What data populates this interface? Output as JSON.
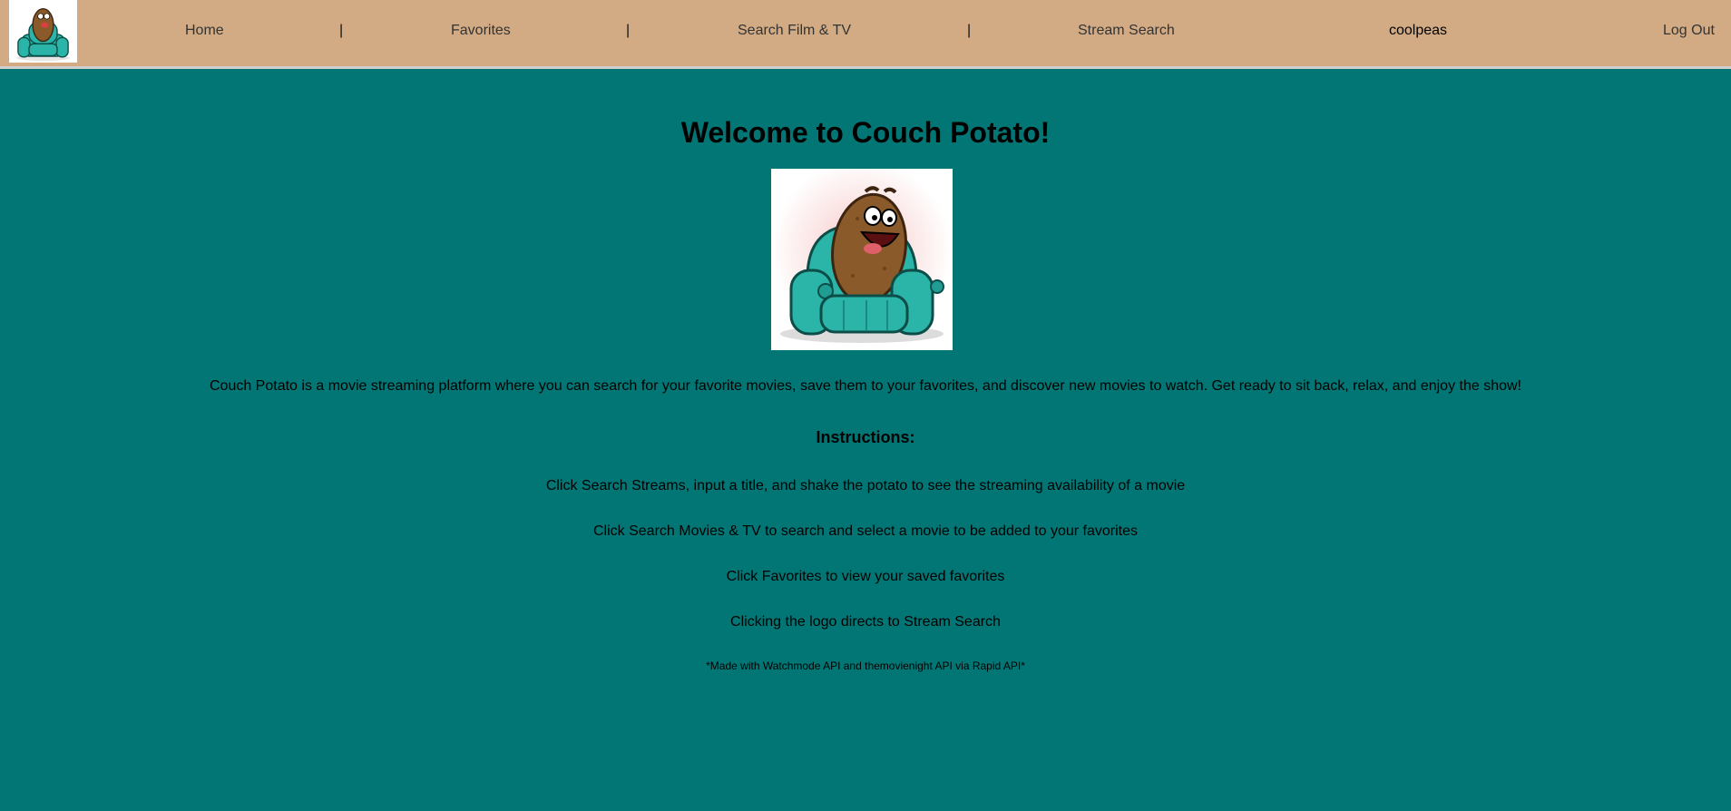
{
  "nav": {
    "logo_alt": "Couch Potato logo",
    "home": "Home",
    "favorites": "Favorites",
    "search_film_tv": "Search Film & TV",
    "stream_search": "Stream Search",
    "separator": "|",
    "username": "coolpeas",
    "logout": "Log Out"
  },
  "main": {
    "title": "Welcome to Couch Potato!",
    "description": "Couch Potato is a movie streaming platform where you can search for your favorite movies, save them to your favorites, and discover new movies to watch. Get ready to sit back, relax, and enjoy the show!",
    "instructions_title": "Instructions:",
    "instructions": [
      "Click Search Streams, input a title, and shake the potato to see the streaming availability of a movie",
      "Click Search Movies & TV to search and select a movie to be added to your favorites",
      "Click Favorites to view your saved favorites",
      "Clicking the logo directs to Stream Search"
    ],
    "footnote": "*Made with Watchmode API and themovienight API via Rapid API*"
  },
  "colors": {
    "nav_bg": "#d2ab84",
    "page_bg": "#027674",
    "couch": "#2bb5a8",
    "potato": "#8b5a2b"
  }
}
